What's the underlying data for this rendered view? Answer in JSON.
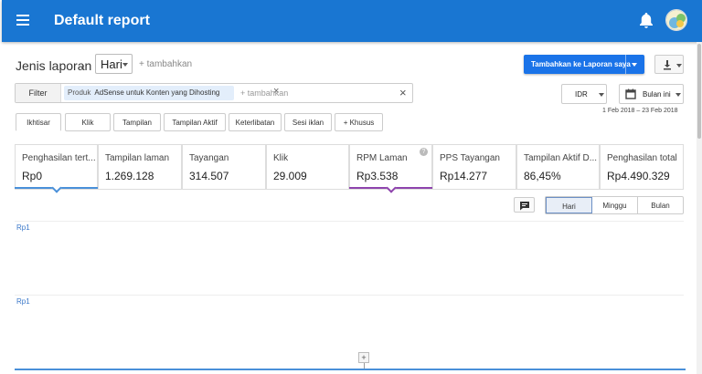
{
  "appbar": {
    "title": "Default report",
    "menu_icon": "menu-icon",
    "notification_icon": "bell-icon",
    "avatar_icon": "avatar-icon"
  },
  "report": {
    "dimension_label": "Jenis laporan",
    "dimension_value": "Hari",
    "add_dimension": "+ tambahkan",
    "add_to_reports_button": "Tambahkan ke Laporan saya",
    "download_icon": "download-icon"
  },
  "filter": {
    "label": "Filter",
    "chip_key": "Produk",
    "chip_value": "AdSense untuk Konten yang Dihosting",
    "add_placeholder": "+ tambahkan",
    "chip_close": "×",
    "clear": "×"
  },
  "currency": {
    "value": "IDR"
  },
  "date": {
    "value": "Bulan ini",
    "range": "1 Feb 2018 – 23 Feb 2018"
  },
  "tabs": [
    {
      "label": "Ikhtisar",
      "active": true
    },
    {
      "label": "Klik"
    },
    {
      "label": "Tampilan"
    },
    {
      "label": "Tampilan Aktif"
    },
    {
      "label": "Keterlibatan"
    },
    {
      "label": "Sesi iklan"
    },
    {
      "label": "+ Khusus"
    }
  ],
  "metrics": [
    {
      "name": "Penghasilan tert...",
      "value": "Rp0",
      "selected": true,
      "color": "#4a90d9"
    },
    {
      "name": "Tampilan laman",
      "value": "1.269.128"
    },
    {
      "name": "Tayangan",
      "value": "314.507"
    },
    {
      "name": "Klik",
      "value": "29.009"
    },
    {
      "name": "RPM Laman",
      "value": "Rp3.538",
      "selected": true,
      "color": "#8e44ad",
      "help": "?"
    },
    {
      "name": "PPS Tayangan",
      "value": "Rp14.277"
    },
    {
      "name": "Tampilan Aktif D...",
      "value": "86,45%"
    },
    {
      "name": "Penghasilan total",
      "value": "Rp4.490.329"
    }
  ],
  "chart": {
    "comment_icon": "comment-icon",
    "periods": [
      "Hari",
      "Minggu",
      "Bulan"
    ],
    "selected_period": "Hari",
    "axis_labels": [
      "Rp1",
      "Rp1"
    ],
    "handle": "+"
  },
  "colors": {
    "appbar": "#1976d2",
    "primary_button": "#1a73e8",
    "accent_blue": "#4a90d9",
    "accent_purple": "#8e44ad"
  }
}
